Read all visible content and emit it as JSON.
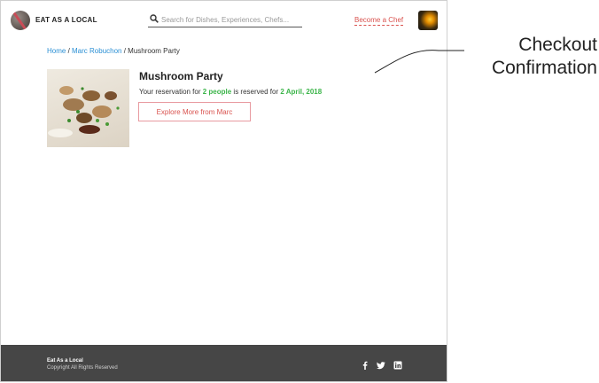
{
  "header": {
    "brand": "EAT AS A LOCAL",
    "search_placeholder": "Search for Dishes, Experiences, Chefs...",
    "become_chef": "Become a Chef"
  },
  "breadcrumb": {
    "home": "Home",
    "sep1": " / ",
    "chef": "Marc Robuchon",
    "sep2": " / ",
    "current": "Mushroom Party"
  },
  "reservation": {
    "title": "Mushroom Party",
    "text_before": "Your reservation for ",
    "people": "2 people",
    "text_middle": " is reserved for ",
    "date": "2 April, 2018",
    "button_label": "Explore More from Marc"
  },
  "footer": {
    "title": "Eat As a Local",
    "copyright": "Copyright All Rights Reserved",
    "social": [
      "facebook-icon",
      "twitter-icon",
      "linkedin-icon"
    ]
  },
  "annotation": {
    "line1": "Checkout",
    "line2": "Confirmation"
  },
  "colors": {
    "accent_red": "#d9534f",
    "link_blue": "#2a8fd4",
    "highlight_green": "#3cb54a",
    "footer_bg": "#464646"
  }
}
